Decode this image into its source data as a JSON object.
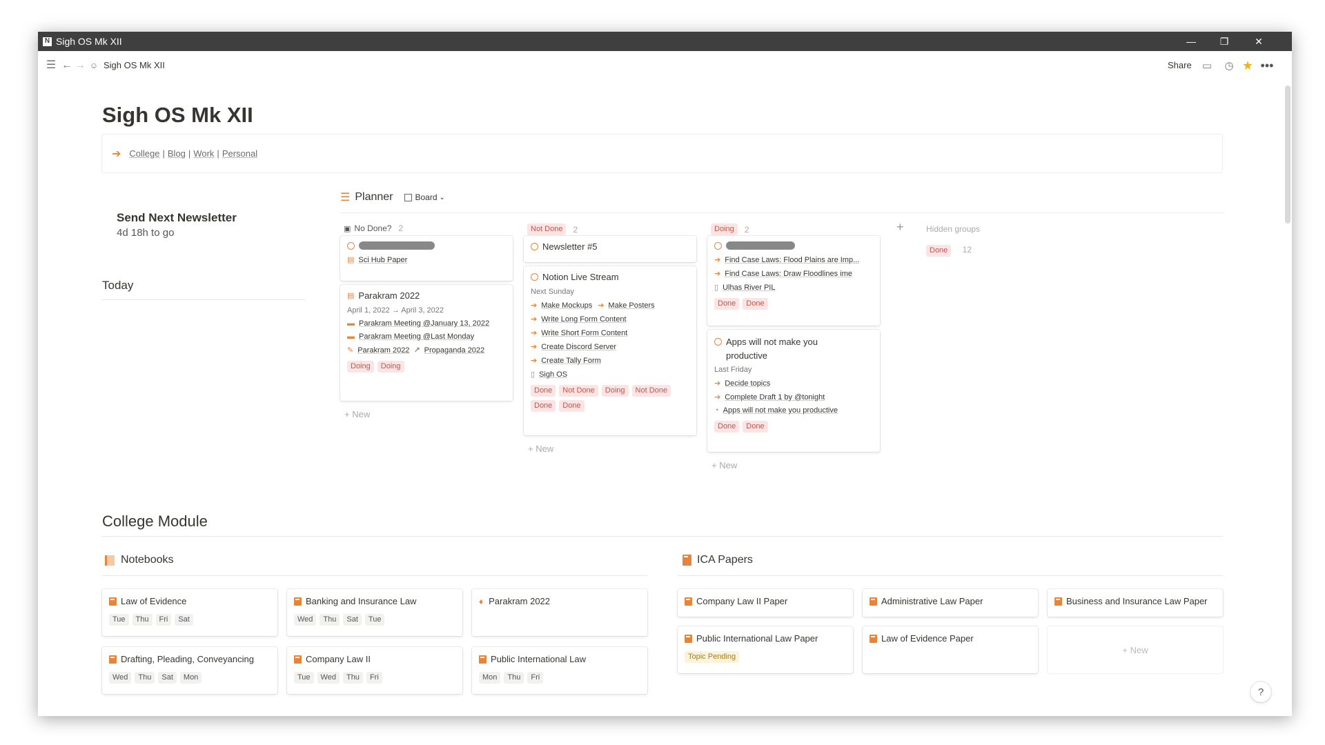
{
  "window": {
    "title": "Sigh OS Mk XII",
    "min": "—",
    "max": "❐",
    "close": "✕"
  },
  "topbar": {
    "breadcrumb": "Sigh OS Mk XII",
    "share": "Share"
  },
  "page": {
    "title": "Sigh OS Mk XII"
  },
  "callout": {
    "links": [
      "College",
      "Blog",
      "Work",
      "Personal"
    ],
    "sep": "|"
  },
  "newsletter": {
    "title": "Send Next Newsletter",
    "countdown": "4d 18h to go"
  },
  "today": "Today",
  "planner": {
    "title": "Planner",
    "view": "Board",
    "columns": [
      {
        "name": "No Done?",
        "count": "2"
      },
      {
        "name": "Not Done",
        "count": "2"
      },
      {
        "name": "Doing",
        "count": "2"
      }
    ],
    "hidden_groups": "Hidden groups",
    "hidden": {
      "name": "Done",
      "count": "12"
    },
    "new_label": "New",
    "cards": {
      "c1": {
        "sub": "Sci Hub Paper"
      },
      "c2": {
        "title": "Parakram 2022",
        "date": "April 1, 2022 → April 3, 2022",
        "rows": [
          "Parakram Meeting @January 13, 2022",
          "Parakram Meeting @Last Monday"
        ],
        "link1": "Parakram 2022",
        "link2": "Propaganda 2022",
        "tags": [
          "Doing",
          "Doing"
        ]
      },
      "c3": {
        "title": "Newsletter #5"
      },
      "c4": {
        "title": "Notion Live Stream",
        "date": "Next Sunday",
        "r1a": "Make Mockups",
        "r1b": "Make Posters",
        "rows": [
          "Write Long Form Content",
          "Write Short Form Content",
          "Create Discord Server",
          "Create Tally Form"
        ],
        "page": "Sigh OS",
        "tags": [
          "Done",
          "Not Done",
          "Doing",
          "Not Done",
          "Done",
          "Done"
        ]
      },
      "c5": {
        "rows": [
          "Find Case Laws: Flood Plains are Imp...",
          "Find Case Laws: Draw Floodlines ime"
        ],
        "page": "Ulhas River PIL",
        "tags": [
          "Done",
          "Done"
        ]
      },
      "c6": {
        "title": "Apps will not make you productive",
        "date": "Last Friday",
        "rows": [
          "Decide topics",
          "Complete Draft 1 by @tonight"
        ],
        "page": "Apps will not make you productive",
        "tags": [
          "Done",
          "Done"
        ]
      }
    }
  },
  "college": {
    "title": "College Module",
    "notebooks": {
      "title": "Notebooks",
      "items": [
        {
          "name": "Law of Evidence",
          "days": [
            "Tue",
            "Thu",
            "Fri",
            "Sat"
          ]
        },
        {
          "name": "Banking and Insurance Law",
          "days": [
            "Wed",
            "Thu",
            "Sat",
            "Tue"
          ]
        },
        {
          "name": "Parakram 2022",
          "days": []
        },
        {
          "name": "Drafting, Pleading, Conveyancing",
          "days": [
            "Wed",
            "Thu",
            "Sat",
            "Mon"
          ]
        },
        {
          "name": "Company Law II",
          "days": [
            "Tue",
            "Wed",
            "Thu",
            "Fri"
          ]
        },
        {
          "name": "Public International Law",
          "days": [
            "Mon",
            "Thu",
            "Fri"
          ]
        }
      ]
    },
    "ica": {
      "title": "ICA Papers",
      "items": [
        {
          "name": "Company Law II Paper"
        },
        {
          "name": "Administrative Law Paper"
        },
        {
          "name": "Business and Insurance Law Paper"
        },
        {
          "name": "Public International Law Paper",
          "tag": "Topic Pending"
        },
        {
          "name": "Law of Evidence Paper"
        }
      ],
      "new_label": "New"
    }
  },
  "help": "?"
}
